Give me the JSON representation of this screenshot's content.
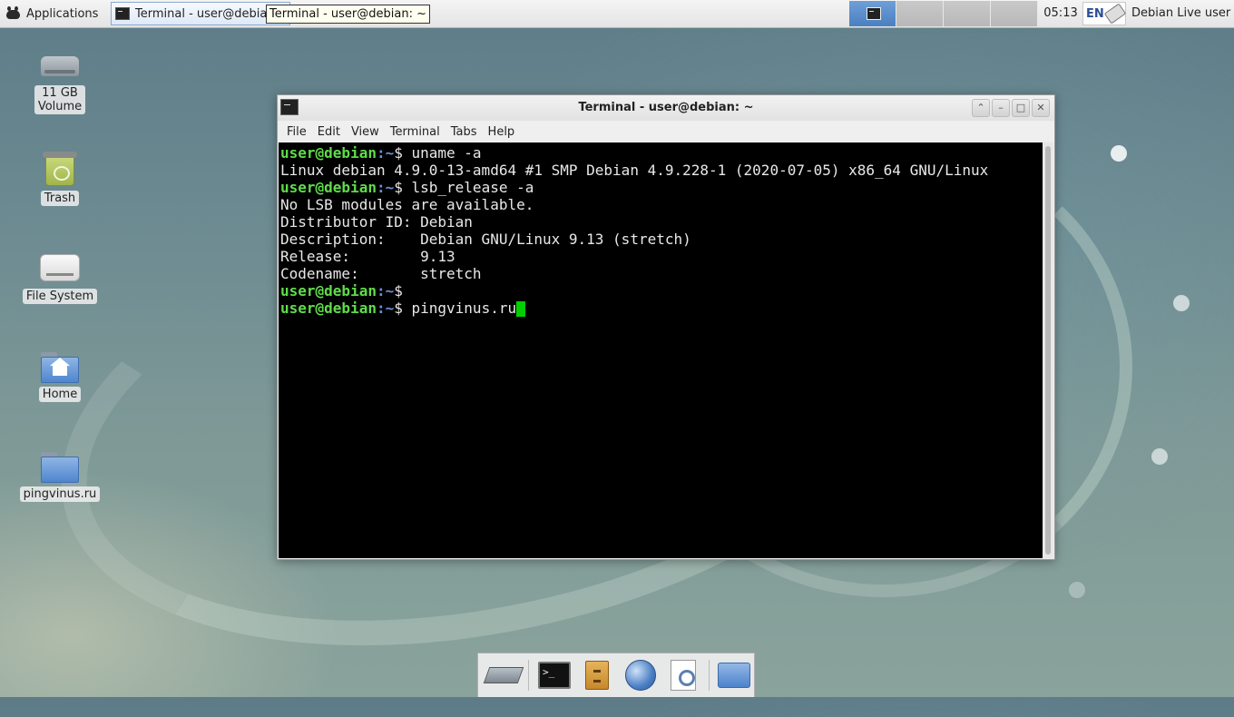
{
  "panel": {
    "applications_label": "Applications",
    "task_label": "Terminal - user@debian: ~",
    "tooltip": "Terminal - user@debian: ~",
    "clock": "05:13",
    "keyboard_layout": "EN",
    "user": "Debian Live user"
  },
  "desktop": {
    "icons": [
      {
        "label": "11 GB\nVolume"
      },
      {
        "label": "Trash"
      },
      {
        "label": "File System"
      },
      {
        "label": "Home"
      },
      {
        "label": "pingvinus.ru"
      }
    ]
  },
  "terminal": {
    "title": "Terminal - user@debian: ~",
    "menu": [
      "File",
      "Edit",
      "View",
      "Terminal",
      "Tabs",
      "Help"
    ],
    "prompt_user": "user@debian",
    "prompt_path": ":~",
    "lines": [
      {
        "type": "cmd",
        "text": "$ uname -a"
      },
      {
        "type": "out",
        "text": "Linux debian 4.9.0-13-amd64 #1 SMP Debian 4.9.228-1 (2020-07-05) x86_64 GNU/Linux"
      },
      {
        "type": "cmd",
        "text": "$ lsb_release -a"
      },
      {
        "type": "out",
        "text": "No LSB modules are available."
      },
      {
        "type": "out",
        "text": "Distributor ID: Debian"
      },
      {
        "type": "out",
        "text": "Description:    Debian GNU/Linux 9.13 (stretch)"
      },
      {
        "type": "out",
        "text": "Release:        9.13"
      },
      {
        "type": "out",
        "text": "Codename:       stretch"
      },
      {
        "type": "cmd",
        "text": "$"
      },
      {
        "type": "cmd",
        "text": "$ pingvinus.ru",
        "cursor": true
      }
    ]
  }
}
